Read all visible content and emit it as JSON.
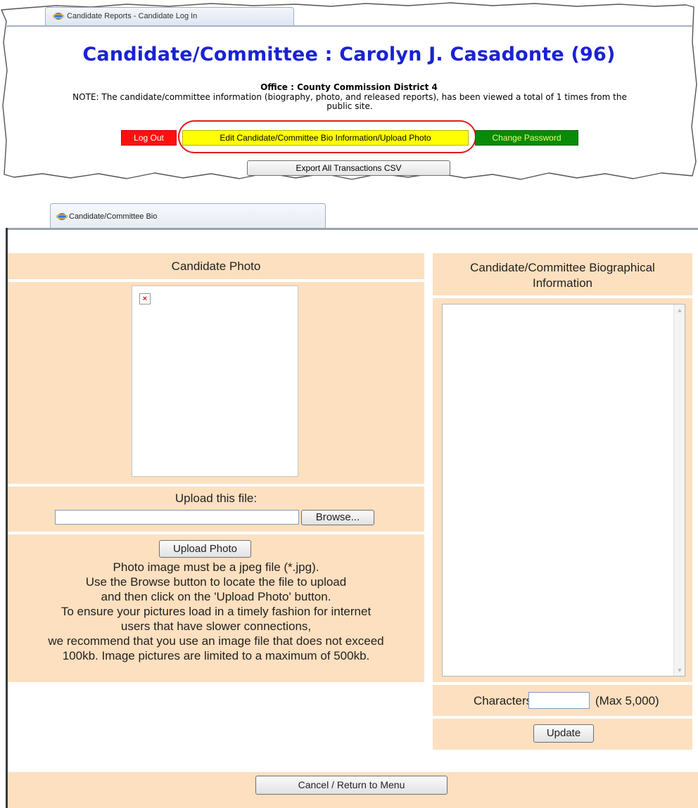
{
  "top_tab": {
    "label": "Candidate Reports - Candidate Log In"
  },
  "header": {
    "title": "Candidate/Committee : Carolyn J. Casadonte (96)",
    "office": "Office : County Commission District 4",
    "note_line1": "NOTE: The candidate/committee information (biography, photo, and released reports), has been viewed a total of 1 times from the",
    "note_line2": "public site."
  },
  "actions": {
    "logout": "Log Out",
    "edit_bio": "Edit Candidate/Committee Bio Information/Upload Photo",
    "change_password": "Change Password",
    "export_csv": "Export All Transactions CSV"
  },
  "bio_tab": {
    "label": "Candidate/Committee Bio"
  },
  "photo_section": {
    "header": "Candidate Photo",
    "upload_label": "Upload this file:",
    "file_value": "",
    "browse_label": "Browse...",
    "upload_button": "Upload Photo",
    "instructions": [
      "Photo image must be a jpeg file (*.jpg).",
      "Use the Browse button to locate the file to upload",
      "and then click on the 'Upload Photo' button.",
      "To ensure your pictures load in a timely fashion for internet",
      "users that have slower connections,",
      "we recommend that you use an image file that does not exceed",
      "100kb. Image pictures are limited to a maximum of 500kb."
    ]
  },
  "bio_section": {
    "header_line1": "Candidate/Committee Biographical",
    "header_line2": "Information",
    "bio_text": "",
    "characters_label": "Characters",
    "characters_value": "",
    "max_label": "(Max 5,000)",
    "update_button": "Update"
  },
  "footer": {
    "cancel_button": "Cancel / Return to Menu"
  },
  "colors": {
    "title": "#1a22d4",
    "panel_bg": "#fde0bf",
    "logout_bg": "#ff1010",
    "edit_bg": "#ffff00",
    "password_bg": "#0a8a0a",
    "highlight": "#e21b1b"
  },
  "icons": {
    "browser_tab_icon": "ie-icon",
    "broken_image_icon": "broken-image-icon"
  }
}
